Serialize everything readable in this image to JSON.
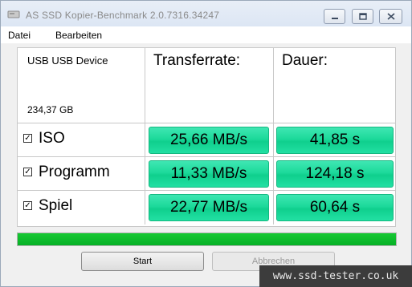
{
  "window": {
    "title": "AS SSD Kopier-Benchmark 2.0.7316.34247",
    "minimize_icon": "minimize-icon",
    "maximize_icon": "maximize-icon",
    "close_icon": "close-icon"
  },
  "menu": {
    "items": [
      "Datei",
      "Bearbeiten"
    ]
  },
  "device": {
    "name": "USB USB Device",
    "size": "234,37 GB"
  },
  "columns": {
    "transfer": "Transferrate:",
    "duration": "Dauer:"
  },
  "rows": [
    {
      "checked": true,
      "label": "ISO",
      "rate": "25,66 MB/s",
      "time": "41,85 s"
    },
    {
      "checked": true,
      "label": "Programm",
      "rate": "11,33 MB/s",
      "time": "124,18 s"
    },
    {
      "checked": true,
      "label": "Spiel",
      "rate": "22,77 MB/s",
      "time": "60,64 s"
    }
  ],
  "progress": {
    "percent": 100,
    "color": "#0cbf2c"
  },
  "buttons": {
    "start": "Start",
    "cancel": "Abbrechen"
  },
  "watermark": "www.ssd-tester.co.uk",
  "colors": {
    "result_green": "#1cd99a",
    "progress_green": "#0cbf2c"
  }
}
